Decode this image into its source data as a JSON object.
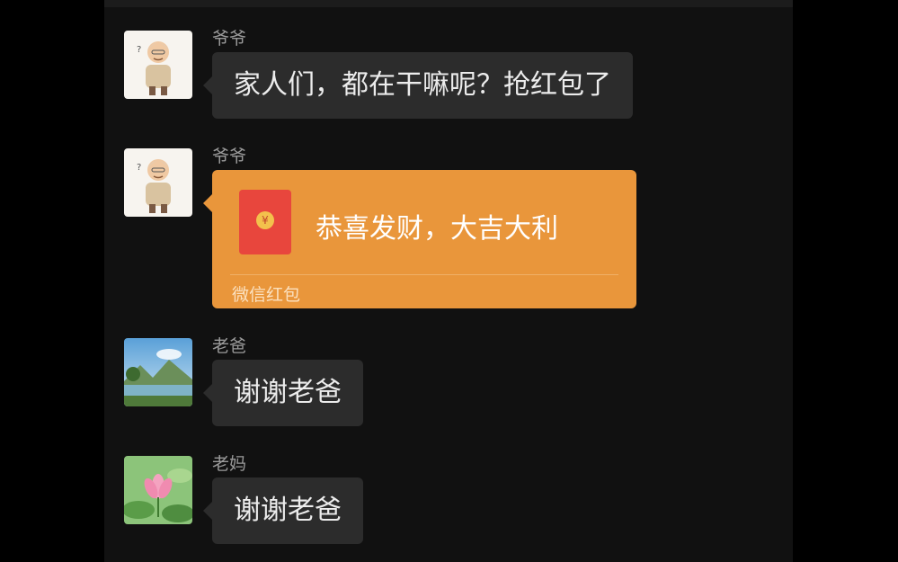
{
  "messages": [
    {
      "sender": "爷爷",
      "avatar": "grandpa-cartoon-avatar",
      "type": "text",
      "text": "家人们，都在干嘛呢？抢红包了"
    },
    {
      "sender": "爷爷",
      "avatar": "grandpa-cartoon-avatar",
      "type": "red_packet",
      "title": "恭喜发财，大吉大利",
      "footer": "微信红包",
      "icon": "red-envelope-icon"
    },
    {
      "sender": "老爸",
      "avatar": "landscape-lake-avatar",
      "type": "text",
      "text": "谢谢老爸"
    },
    {
      "sender": "老妈",
      "avatar": "lotus-flower-avatar",
      "type": "text",
      "text": "谢谢老爸"
    }
  ],
  "colors": {
    "background": "#111111",
    "bubble": "#2c2c2c",
    "red_packet": "#e9963b",
    "envelope": "#e8463d",
    "sender_name": "#9a9a9a"
  }
}
